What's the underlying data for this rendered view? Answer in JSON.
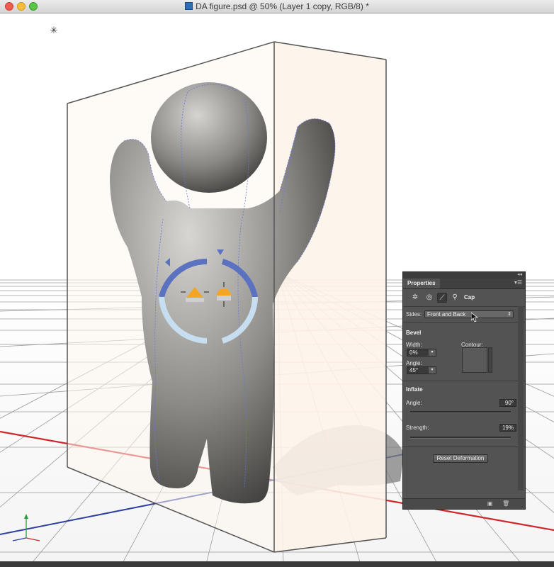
{
  "window": {
    "title": "DA figure.psd @ 50% (Layer 1 copy, RGB/8) *"
  },
  "properties_panel": {
    "tab_label": "Properties",
    "mode_label": "Cap",
    "sides": {
      "label": "Sides:",
      "value": "Front and Back"
    },
    "bevel": {
      "heading": "Bevel",
      "width_label": "Width:",
      "width_value": "0%",
      "angle_label": "Angle:",
      "angle_value": "45°",
      "contour_label": "Contour:"
    },
    "inflate": {
      "heading": "Inflate",
      "angle_label": "Angle:",
      "angle_value": "90°",
      "strength_label": "Strength:",
      "strength_value": "19%"
    },
    "reset_button": "Reset Deformation",
    "icons": [
      "mesh-icon",
      "deform-icon",
      "cap-icon",
      "coordinates-icon"
    ]
  },
  "colors": {
    "panel_bg": "#535353",
    "x_axis": "#d0262b",
    "z_axis": "#2f3fa0",
    "y_axis": "#2a9e3a",
    "widget_blue": "#5b72c0"
  }
}
